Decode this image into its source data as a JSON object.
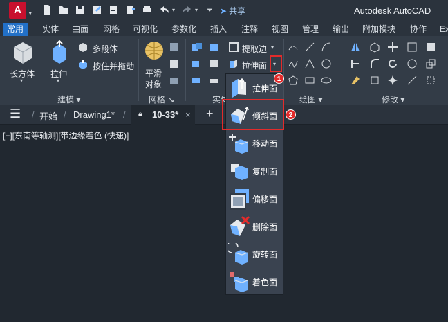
{
  "app": {
    "logo_letter": "A",
    "share_label": "共享",
    "window_title": "Autodesk AutoCAD"
  },
  "ribbon_tabs": [
    "常用",
    "实体",
    "曲面",
    "网格",
    "可视化",
    "参数化",
    "插入",
    "注释",
    "视图",
    "管理",
    "输出",
    "附加模块",
    "协作",
    "Ex"
  ],
  "ribbon": {
    "modeling": {
      "box_label": "长方体",
      "extrude_label": "拉伸",
      "polysolid_label": "多段体",
      "presspull_label": "按住并拖动",
      "panel_title": "建模"
    },
    "mesh": {
      "smooth_label_1": "平滑",
      "smooth_label_2": "对象",
      "panel_title": "网格"
    },
    "solid_editing": {
      "extract_edges_label": "提取边",
      "extrude_faces_label": "拉伸面",
      "panel_title": "实体"
    },
    "draw": {
      "panel_title": "绘图"
    },
    "modify": {
      "panel_title": "修改"
    }
  },
  "file_tabs": {
    "start": "开始",
    "drawing1": "Drawing1*",
    "active": "10-33*",
    "close_glyph": "×",
    "add_glyph": "+"
  },
  "viewport_label": "[−][东南等轴测][带边缘着色 (快速)]",
  "dropdown_items": [
    {
      "label": "拉伸面",
      "icon": "extrude-face-icon"
    },
    {
      "label": "倾斜面",
      "icon": "taper-face-icon"
    },
    {
      "label": "移动面",
      "icon": "move-face-icon"
    },
    {
      "label": "复制面",
      "icon": "copy-face-icon"
    },
    {
      "label": "偏移面",
      "icon": "offset-face-icon"
    },
    {
      "label": "删除面",
      "icon": "delete-face-icon"
    },
    {
      "label": "旋转面",
      "icon": "rotate-face-icon"
    },
    {
      "label": "着色面",
      "icon": "color-face-icon"
    }
  ],
  "annotations": {
    "badge_1": "1",
    "badge_2": "2"
  },
  "colors": {
    "accent_blue": "#2270c7",
    "highlight_red": "#e32b2b",
    "face_blue": "#6fb1ff",
    "background": "#212830"
  }
}
